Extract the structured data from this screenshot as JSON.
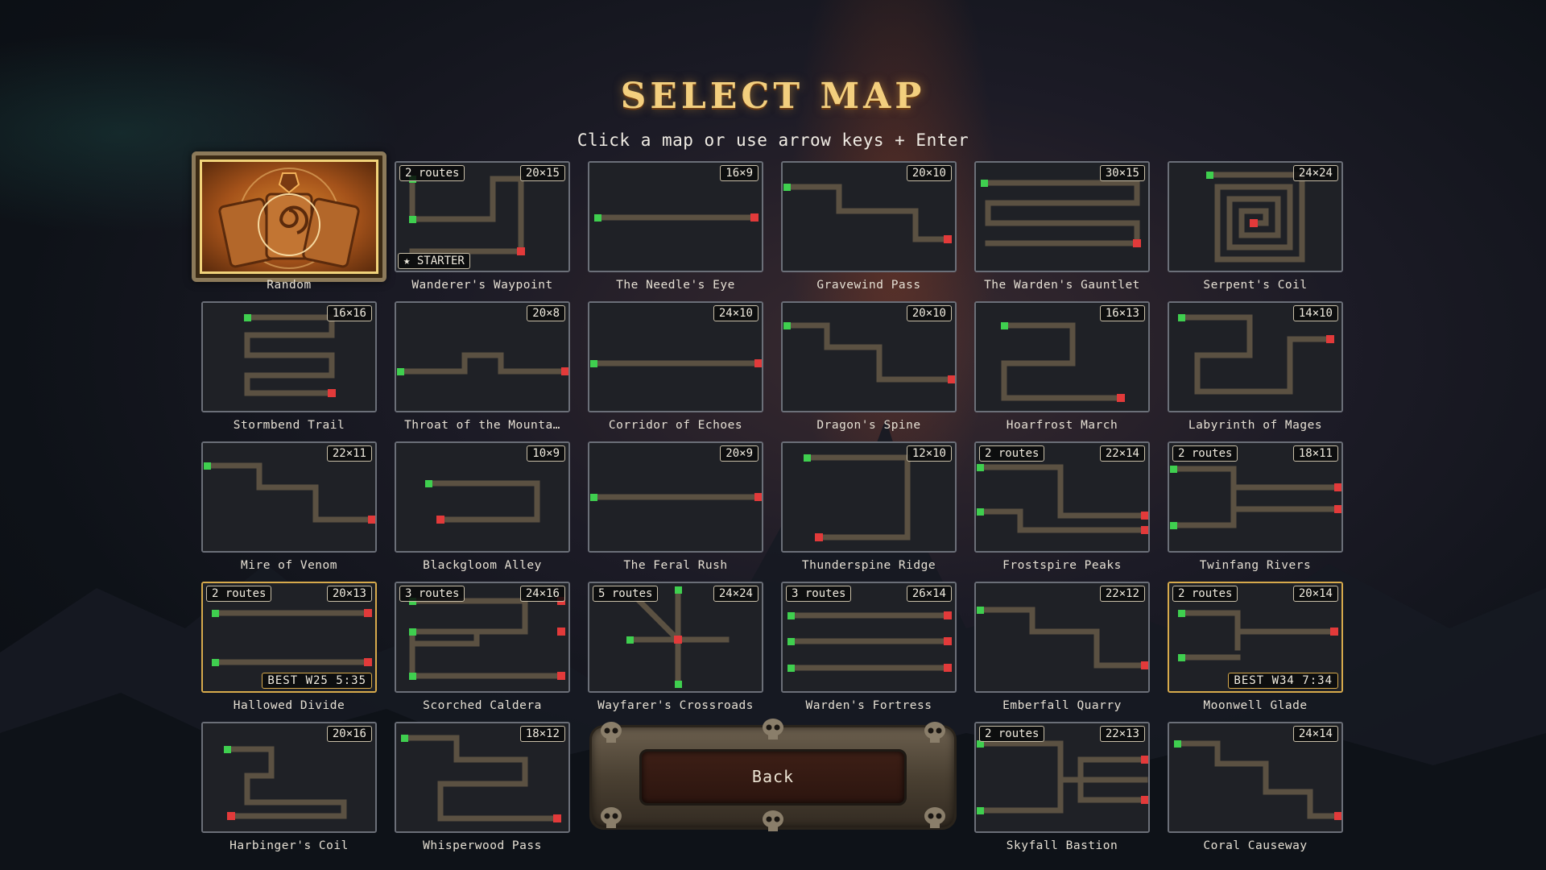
{
  "header": {
    "title": "SELECT MAP",
    "subtitle": "Click a map or use arrow keys + Enter"
  },
  "maps": [
    {
      "name": "Random",
      "kind": "random"
    },
    {
      "name": "Wanderer's Waypoint",
      "size": "20×15",
      "routes": "2 routes",
      "starter": "★ STARTER"
    },
    {
      "name": "The Needle's Eye",
      "size": "16×9"
    },
    {
      "name": "Gravewind Pass",
      "size": "20×10"
    },
    {
      "name": "The Warden's Gauntlet",
      "size": "30×15"
    },
    {
      "name": "Serpent's Coil",
      "size": "24×24"
    },
    {
      "name": "Stormbend Trail",
      "size": "16×16"
    },
    {
      "name": "Throat of the Mounta…",
      "size": "20×8"
    },
    {
      "name": "Corridor of Echoes",
      "size": "24×10"
    },
    {
      "name": "Dragon's Spine",
      "size": "20×10"
    },
    {
      "name": "Hoarfrost March",
      "size": "16×13"
    },
    {
      "name": "Labyrinth of Mages",
      "size": "14×10"
    },
    {
      "name": "Mire of Venom",
      "size": "22×11"
    },
    {
      "name": "Blackgloom Alley",
      "size": "10×9"
    },
    {
      "name": "The Feral Rush",
      "size": "20×9"
    },
    {
      "name": "Thunderspine Ridge",
      "size": "12×10"
    },
    {
      "name": "Frostspire Peaks",
      "size": "22×14",
      "routes": "2 routes"
    },
    {
      "name": "Twinfang Rivers",
      "size": "18×11",
      "routes": "2 routes"
    },
    {
      "name": "Hallowed Divide",
      "size": "20×13",
      "routes": "2 routes",
      "best": "BEST  W25  5:35",
      "highlight": true
    },
    {
      "name": "Scorched Caldera",
      "size": "24×16",
      "routes": "3 routes"
    },
    {
      "name": "Wayfarer's Crossroads",
      "size": "24×24",
      "routes": "5 routes"
    },
    {
      "name": "Warden's Fortress",
      "size": "26×14",
      "routes": "3 routes"
    },
    {
      "name": "Emberfall Quarry",
      "size": "22×12"
    },
    {
      "name": "Moonwell Glade",
      "size": "20×14",
      "routes": "2 routes",
      "best": "BEST  W34  7:34",
      "highlight": true
    },
    {
      "name": "Harbinger's Coil",
      "size": "20×16"
    },
    {
      "name": "Whisperwood Pass",
      "size": "18×12"
    },
    {
      "name": "Skyfall Bastion",
      "size": "22×13",
      "routes": "2 routes"
    },
    {
      "name": "Coral Causeway",
      "size": "24×14"
    }
  ],
  "back_button": {
    "label": "Back"
  },
  "colors": {
    "title_gold": "#f3cf7e",
    "path": "#5b5142",
    "spawn_green": "#3fcf4f",
    "exit_red": "#e23a3a",
    "best_border": "#d7aa4c"
  }
}
